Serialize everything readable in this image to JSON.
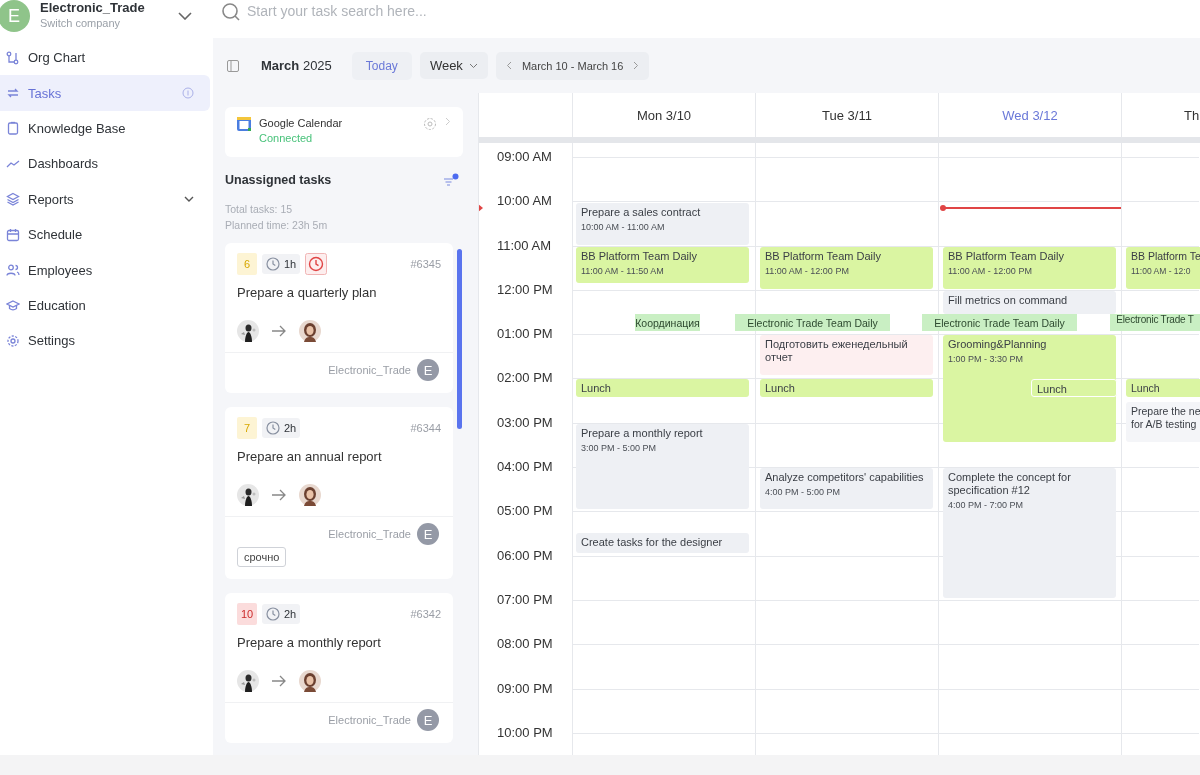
{
  "company": {
    "avatar": "E",
    "name": "Electronic_Trade",
    "subtitle": "Switch company"
  },
  "search": {
    "placeholder": "Start your task search here..."
  },
  "sidebar": {
    "items": [
      {
        "label": "Org Chart",
        "selected": false,
        "expandable": false,
        "help": false
      },
      {
        "label": "Tasks",
        "selected": true,
        "expandable": false,
        "help": true
      },
      {
        "label": "Knowledge Base",
        "selected": false,
        "expandable": false,
        "help": false
      },
      {
        "label": "Dashboards",
        "selected": false,
        "expandable": false,
        "help": false
      },
      {
        "label": "Reports",
        "selected": false,
        "expandable": true,
        "help": false
      },
      {
        "label": "Schedule",
        "selected": false,
        "expandable": false,
        "help": false
      },
      {
        "label": "Employees",
        "selected": false,
        "expandable": false,
        "help": false
      },
      {
        "label": "Education",
        "selected": false,
        "expandable": false,
        "help": false
      },
      {
        "label": "Settings",
        "selected": false,
        "expandable": false,
        "help": false
      }
    ]
  },
  "toolbar": {
    "title": "**March** 2025",
    "today": "Today",
    "view": "Week",
    "range": "March 10 - March 16"
  },
  "calendar_sync": {
    "name": "Google Calendar",
    "status": "Connected"
  },
  "unassigned": {
    "title": "Unassigned tasks",
    "filter_active": true,
    "total": "Total tasks: 15",
    "planned": "Planned time: 23h 5m",
    "tasks": [
      {
        "priority": "6",
        "color": "#fdf4d4",
        "duration": "1h",
        "overdue": true,
        "number": "#6345",
        "title": "Prepare a quarterly plan",
        "company": "Electronic_Trade",
        "company_avatar": "E"
      },
      {
        "priority": "7",
        "color": "#fdf4d4",
        "duration": "2h",
        "overdue": false,
        "number": "#6344",
        "title": "Prepare an annual report",
        "company": "Electronic_Trade",
        "company_avatar": "E",
        "tags": [
          "срочно"
        ]
      },
      {
        "priority": "10",
        "color": "#fbdcdc",
        "duration": "2h",
        "overdue": false,
        "number": "#6342",
        "title": "Prepare a monthly report",
        "company": "Electronic_Trade",
        "company_avatar": "E"
      }
    ]
  },
  "calendar": {
    "times": [
      "09:00 AM",
      "10:00 AM",
      "11:00 AM",
      "12:00 PM",
      "01:00 PM",
      "02:00 PM",
      "03:00 PM",
      "04:00 PM",
      "05:00 PM",
      "06:00 PM",
      "07:00 PM",
      "08:00 PM",
      "09:00 PM",
      "10:00 PM"
    ],
    "days": [
      {
        "label": "Mon 3/10",
        "today": false,
        "now_line": false,
        "events": [
          {
            "kind": "block",
            "title": "Prepare a sales contract",
            "time": "10:00 AM - 11:00 AM",
            "color": "#eef0f4"
          },
          {
            "kind": "block",
            "title": "BB Platform Team Daily",
            "time": "11:00 AM - 11:50 AM",
            "color": "#daf5a2"
          },
          {
            "kind": "label",
            "title": "Координация",
            "color": "#c9efc3"
          },
          {
            "kind": "block",
            "title": "Lunch",
            "color": "#daf5a2"
          },
          {
            "kind": "block",
            "title": "Prepare a monthly report",
            "time": "3:00 PM - 5:00 PM",
            "color": "#eef0f4"
          },
          {
            "kind": "block",
            "title": "Create tasks for the designer",
            "color": "#eef0f4"
          }
        ]
      },
      {
        "label": "Tue 3/11",
        "today": false,
        "now_line": false,
        "events": [
          {
            "kind": "block",
            "title": "BB Platform Team Daily",
            "time": "11:00 AM - 12:00 PM",
            "color": "#daf5a2"
          },
          {
            "kind": "label",
            "title": "Electronic Trade Team Daily",
            "color": "#c9efc3"
          },
          {
            "kind": "block",
            "title": "Подготовить еженедельный отчет",
            "color": "#fdeff0"
          },
          {
            "kind": "block",
            "title": "Lunch",
            "color": "#daf5a2"
          },
          {
            "kind": "block",
            "title": "Analyze competitors' capabilities",
            "time": "4:00 PM - 5:00 PM",
            "color": "#eef0f4"
          }
        ]
      },
      {
        "label": "Wed 3/12",
        "today": true,
        "now_line": true,
        "events": [
          {
            "kind": "block",
            "title": "BB Platform Team Daily",
            "time": "11:00 AM - 12:00 PM",
            "color": "#daf5a2"
          },
          {
            "kind": "block",
            "title": "Fill metrics on command",
            "color": "#eef0f4"
          },
          {
            "kind": "label",
            "title": "Electronic Trade Team Daily",
            "color": "#c9efc3"
          },
          {
            "kind": "block",
            "title": "Grooming&Planning",
            "time": "1:00 PM - 3:30 PM",
            "color": "#daf5a2"
          },
          {
            "kind": "overlay",
            "title": "Lunch",
            "color": "#daf5a2"
          },
          {
            "kind": "block",
            "title": "Complete the concept for specification #12",
            "time": "4:00 PM - 7:00 PM",
            "color": "#eef0f4"
          }
        ]
      },
      {
        "label": "Th",
        "today": false,
        "now_line": false,
        "events": [
          {
            "kind": "block",
            "title": "BB Platform Te",
            "time": "11:00 AM - 12:0",
            "color": "#daf5a2"
          },
          {
            "kind": "label",
            "title": "Electronic Trade T",
            "color": "#c9efc3"
          },
          {
            "kind": "block",
            "title": "Lunch",
            "color": "#daf5a2"
          },
          {
            "kind": "block",
            "title": "Prepare the ne\nfor A/B testing",
            "color": "#f4f5f8"
          }
        ]
      }
    ]
  }
}
